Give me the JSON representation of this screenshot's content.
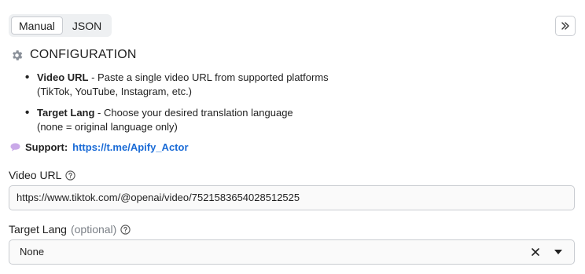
{
  "toggle": {
    "manual": "Manual",
    "json": "JSON"
  },
  "config": {
    "heading": "CONFIGURATION",
    "bullets": [
      {
        "name": "Video URL",
        "line1": " - Paste a single video URL from supported platforms",
        "line2": "(TikTok, YouTube, Instagram, etc.)"
      },
      {
        "name": "Target Lang",
        "line1": " - Choose your desired translation language",
        "line2": "(none = original language only)"
      }
    ],
    "support_label": "Support:",
    "support_link": "https://t.me/Apify_Actor"
  },
  "fields": {
    "video_url": {
      "label": "Video URL",
      "value": "https://www.tiktok.com/@openai/video/7521583654028512525"
    },
    "target_lang": {
      "label": "Target Lang",
      "optional": "(optional)",
      "value": "None"
    }
  },
  "icons": {
    "gear": "gear-icon",
    "chat": "chat-bubble-icon",
    "help": "help-circle-icon",
    "expand": "double-chevron-right-icon",
    "clear": "close-icon",
    "caret": "caret-down-icon"
  },
  "colors": {
    "link": "#1a6bd6",
    "border": "#c9ccd1",
    "toggle_bg": "#eef0f2"
  }
}
